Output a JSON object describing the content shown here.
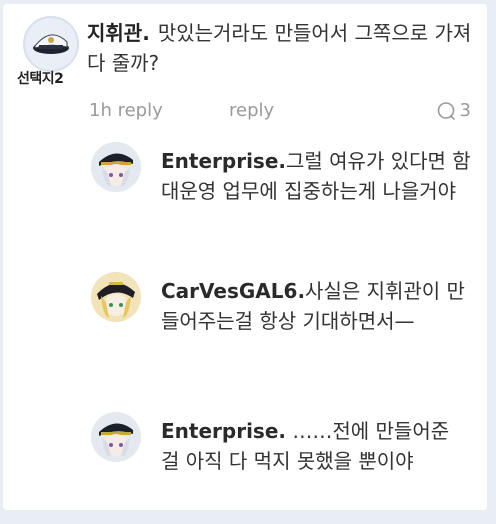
{
  "comment": {
    "author": "지휘관.",
    "text": "맛있는거라도 만들어서 그쪽으로 가져다 줄까?",
    "avatar_caption": "선택지2",
    "time": "1h reply",
    "reply_label": "reply",
    "reply_count": "3"
  },
  "replies": [
    {
      "author": "Enterprise.",
      "text": "그럴 여유가 있다면 함대운영 업무에 집중하는게 나을거야",
      "avatar_icon": "enterprise-avatar"
    },
    {
      "author": "CarVesGAL6.",
      "text": "사실은 지휘관이 만들어주는걸 항상 기대하면서—",
      "avatar_icon": "carvesgal6-avatar"
    },
    {
      "author": "Enterprise.",
      "text": " ……전에 만들어준 걸 아직 다 먹지 못했을 뿐이야",
      "avatar_icon": "enterprise-avatar"
    }
  ],
  "colors": {
    "background": "#e9eef5",
    "card": "#ffffff",
    "meta": "#9a9a9a"
  }
}
